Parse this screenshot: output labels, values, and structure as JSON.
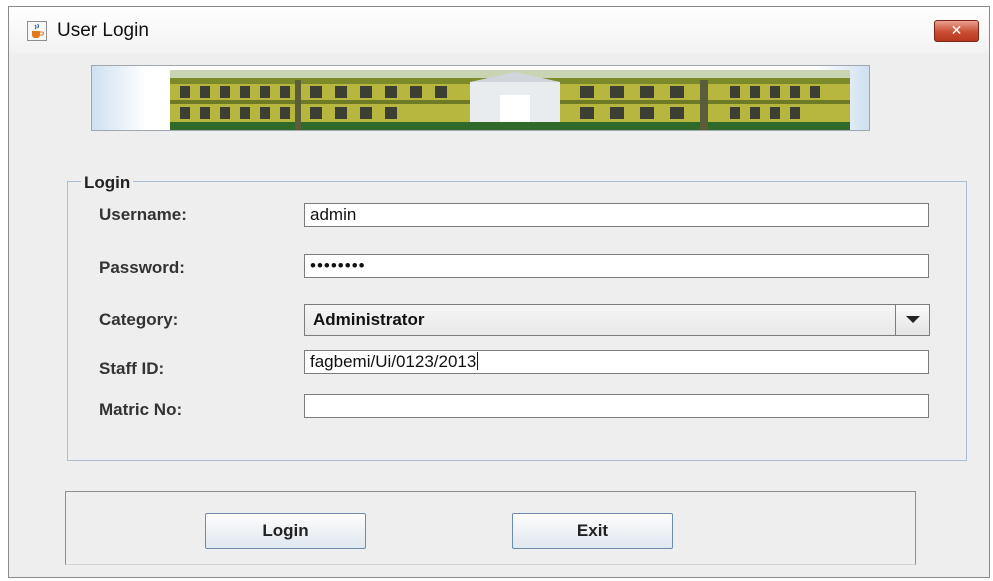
{
  "window": {
    "title": "User Login",
    "close_symbol": "✕",
    "app_icon": "java-cup-icon"
  },
  "banner": {
    "image": "campus-building-photo"
  },
  "form": {
    "legend": "Login",
    "username": {
      "label": "Username:",
      "value": "admin"
    },
    "password": {
      "label": "Password:",
      "value": "••••••••"
    },
    "category": {
      "label": "Category:",
      "value": "Administrator"
    },
    "staff_id": {
      "label": "Staff ID:",
      "value": "fagbemi/Ui/0123/2013"
    },
    "matric_no": {
      "label": "Matric No:",
      "value": ""
    }
  },
  "buttons": {
    "login": "Login",
    "exit": "Exit"
  },
  "colors": {
    "window_bg": "#eeeeee",
    "close_button": "#c94c33",
    "fieldset_border": "#a9bfd6",
    "button_border": "#6d8cab"
  }
}
